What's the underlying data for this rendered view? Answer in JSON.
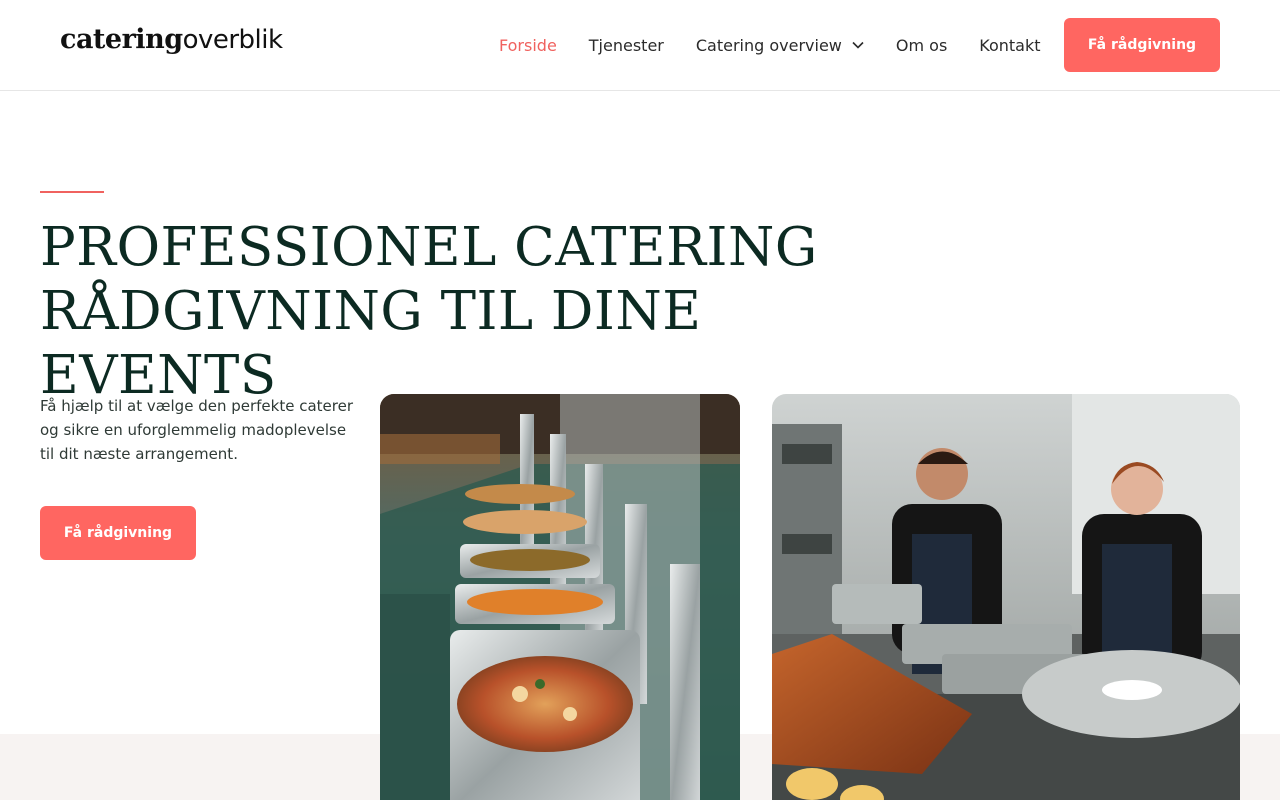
{
  "header": {
    "logo_part1": "catering",
    "logo_part2": "overblik",
    "nav": [
      {
        "label": "Forside",
        "active": true
      },
      {
        "label": "Tjenester"
      },
      {
        "label": "Catering overview",
        "dropdown": true
      },
      {
        "label": "Om os"
      },
      {
        "label": "Kontakt"
      }
    ],
    "cta_label": "Få rådgivning"
  },
  "hero": {
    "title_line1": "PROFESSIONEL CATERING",
    "title_line2": "RÅDGIVNING TIL DINE EVENTS",
    "subtitle": "Få hjælp til at vælge den perfekte caterer og sikre en uforglemmelig madoplevelse til dit næste arrangement.",
    "cta_label": "Få rådgivning"
  },
  "colors": {
    "accent": "#ff6661",
    "nav_active": "#f0625f",
    "heading": "#0c2a22",
    "band": "#f7f3f2"
  },
  "images": [
    {
      "name": "buffet-chafing-dishes-photo"
    },
    {
      "name": "chefs-in-kitchen-photo"
    }
  ]
}
